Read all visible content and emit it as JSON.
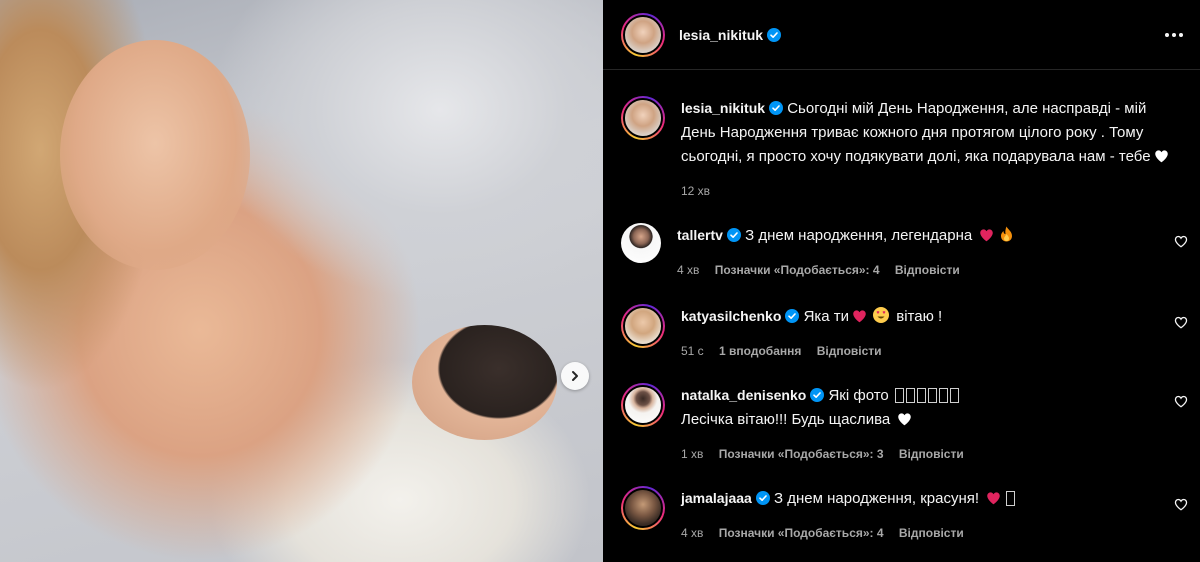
{
  "post": {
    "author": "lesia_nikituk",
    "caption": "Сьогодні мій День Народження, але насправді - мій День Народження триває кожного дня протягом цілого року . Тому сьогодні, я просто хочу подякувати долі, яка подарувала нам - тебе",
    "time": "12 хв"
  },
  "comments": [
    {
      "user": "tallertv",
      "text": "З днем народження, легендарна",
      "time": "4 хв",
      "likes": "Позначки «Подобається»: 4",
      "reply": "Відповісти"
    },
    {
      "user": "katyasilchenko",
      "text_before": "Яка ти",
      "text_after": "вітаю !",
      "time": "51 с",
      "likes": "1 вподобання",
      "reply": "Відповісти"
    },
    {
      "user": "natalka_denisenko",
      "text": "Які фото",
      "line2": "Лесічка вітаю!!! Будь щаслива",
      "time": "1 хв",
      "likes": "Позначки «Подобається»: 3",
      "reply": "Відповісти"
    },
    {
      "user": "jamalajaaa",
      "text": "З днем народження, красуня!",
      "time": "4 хв",
      "likes": "Позначки «Подобається»: 4",
      "reply": "Відповісти"
    }
  ],
  "colors": {
    "verified": "#0095f6",
    "emoji_heart_red": "#e0245e",
    "text_secondary": "#a8a8a8"
  }
}
